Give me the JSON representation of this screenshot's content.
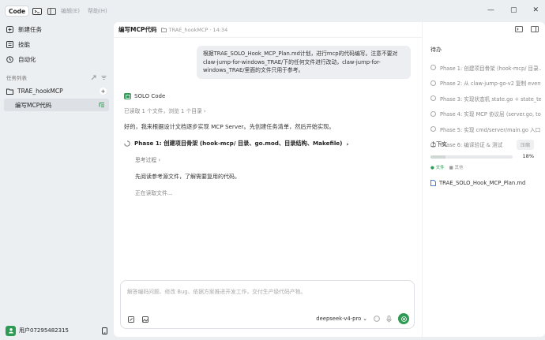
{
  "titlebar": {
    "app_label": "Code",
    "menu": [
      "编辑(E)",
      "帮助(H)"
    ],
    "controls": [
      "—",
      "▢",
      "✕"
    ]
  },
  "sidebar": {
    "nav": [
      {
        "label": "新建任务",
        "icon": "new-task-icon"
      },
      {
        "label": "技能",
        "icon": "skills-icon"
      },
      {
        "label": "自动化",
        "icon": "automation-icon"
      }
    ],
    "section_label": "任务列表",
    "project": {
      "label": "TRAE_hookMCP",
      "add": "+"
    },
    "active_task": "编写MCP代码",
    "user": "用户07295482315"
  },
  "main": {
    "title": "编写MCP代码",
    "subtitle_path": "TRAE_hookMCP",
    "subtitle_time": "14:34",
    "user_message": "根据TRAE_SOLO_Hook_MCP_Plan.md计划，进行mcp的代码编写。注意不要对claw-jump-for-windows_TRAE/下的任何文件进行改动，claw-jump-for-windows_TRAE/里面的文件只用于参考。",
    "assistant_name": "SOLO Code",
    "read_summary": "已读取 1 个文件，浏览 1 个目录",
    "plan_text": "好的，我来根据设计文档逐步实现 MCP Server。先创建任务清单，然后开始实现。",
    "phase_title": "Phase 1: 创建项目骨架 (hook-mcp/ 目录、go.mod、目录结构、Makefile)",
    "thinking_label": "思考过程",
    "sub_text": "先阅读参考源文件，了解需要复用的代码。",
    "reading_label": "正在读取文件..."
  },
  "composer": {
    "placeholder": "解答编码问题、修改 Bug、依据方案推进开发工作，交付生产级代码产物。",
    "model": "deepseek-v4-pro"
  },
  "right_panel": {
    "todo_label": "待办",
    "todos": [
      "Phase 1: 创建项目骨架 (hook-mcp/ 目录...",
      "Phase 2: 从 claw-jump-go-v2 复制 event...",
      "Phase 3: 实现状态机 state.go + state_test...",
      "Phase 4: 实现 MCP 协议层 (server.go, too...",
      "Phase 5: 实现 cmd/server/main.go 入口 + ...",
      "Phase 6: 编译验证 & 测试"
    ],
    "context_label": "上下文",
    "context_button": "压缩",
    "context_progress": 0.18,
    "context_percent": "18%",
    "tabs": [
      "文件",
      "其他"
    ],
    "file": "TRAE_SOLO_Hook_MCP_Plan.md"
  },
  "colors": {
    "accent": "#2e9b55",
    "background": "#eceff2"
  }
}
